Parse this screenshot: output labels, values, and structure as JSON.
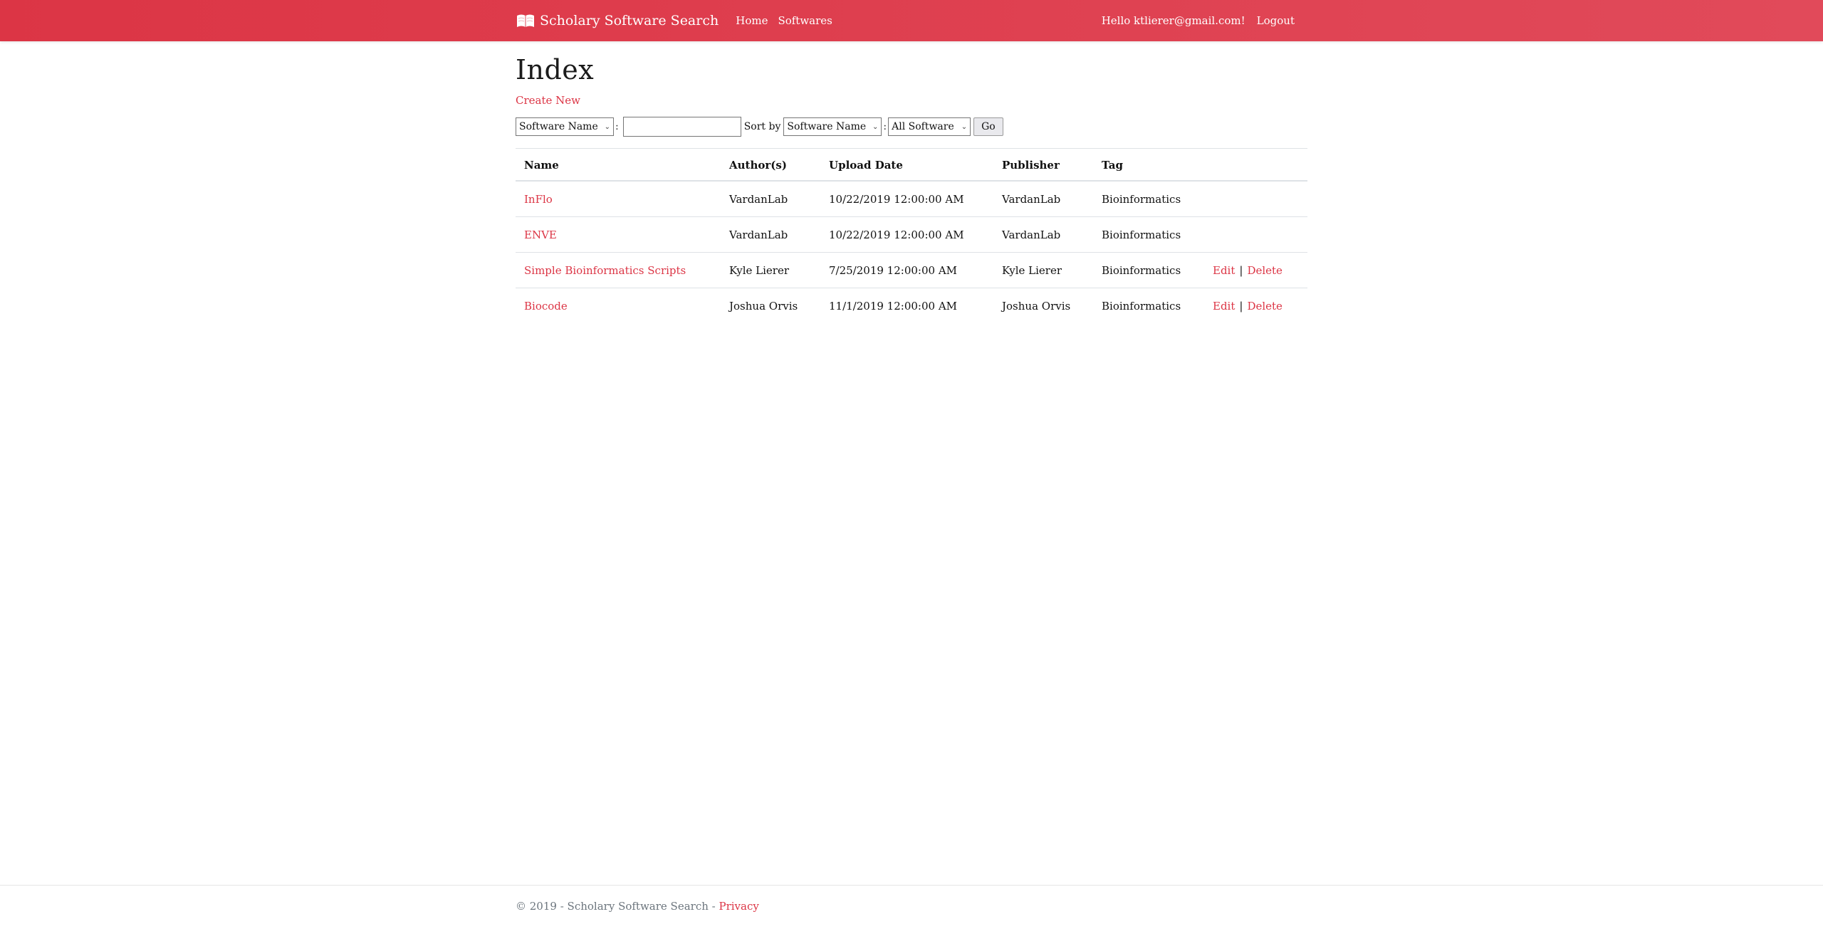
{
  "navbar": {
    "brand": "Scholary Software Search",
    "links": [
      "Home",
      "Softwares"
    ],
    "greeting": "Hello ktlierer@gmail.com!",
    "logout": "Logout",
    "color": "#dc3545"
  },
  "page": {
    "title": "Index",
    "create_new": "Create New"
  },
  "filters": {
    "field_select": "Software Name",
    "search_value": "",
    "colon": ":",
    "sort_label": "Sort by",
    "sort_select": "Software Name",
    "scope_select": "All Software",
    "go": "Go"
  },
  "table": {
    "headers": [
      "Name",
      "Author(s)",
      "Upload Date",
      "Publisher",
      "Tag",
      ""
    ],
    "rows": [
      {
        "name": "InFlo",
        "authors": "VardanLab",
        "upload_date": "10/22/2019 12:00:00 AM",
        "publisher": "VardanLab",
        "tag": "Bioinformatics",
        "edit": "",
        "sep": "",
        "delete": ""
      },
      {
        "name": "ENVE",
        "authors": "VardanLab",
        "upload_date": "10/22/2019 12:00:00 AM",
        "publisher": "VardanLab",
        "tag": "Bioinformatics",
        "edit": "",
        "sep": "",
        "delete": ""
      },
      {
        "name": "Simple Bioinformatics Scripts",
        "authors": "Kyle Lierer",
        "upload_date": "7/25/2019 12:00:00 AM",
        "publisher": "Kyle Lierer",
        "tag": "Bioinformatics",
        "edit": "Edit",
        "sep": "|",
        "delete": "Delete"
      },
      {
        "name": "Biocode",
        "authors": "Joshua Orvis",
        "upload_date": "11/1/2019 12:00:00 AM",
        "publisher": "Joshua Orvis",
        "tag": "Bioinformatics",
        "edit": "Edit",
        "sep": "|",
        "delete": "Delete"
      }
    ]
  },
  "footer": {
    "text": "© 2019 - Scholary Software Search - ",
    "privacy": "Privacy"
  }
}
